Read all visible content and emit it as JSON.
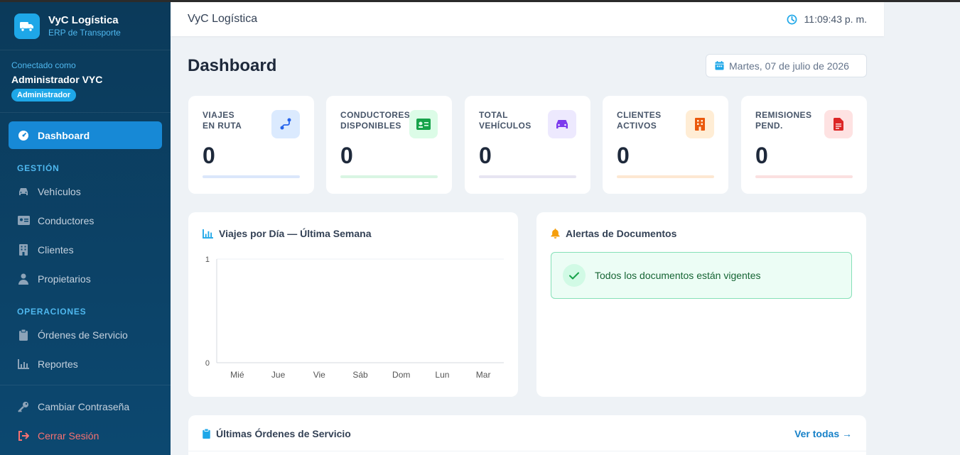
{
  "brand": {
    "name": "VyC Logística",
    "subtitle": "ERP de Transporte"
  },
  "user": {
    "connected_label": "Conectado como",
    "name": "Administrador VYC",
    "role": "Administrador"
  },
  "nav": {
    "dashboard": "Dashboard",
    "section_gestion": "GESTIÓN",
    "vehiculos": "Vehículos",
    "conductores": "Conductores",
    "clientes": "Clientes",
    "propietarios": "Propietarios",
    "section_operaciones": "OPERACIONES",
    "ordenes": "Órdenes de Servicio",
    "reportes": "Reportes",
    "cambiar_password": "Cambiar Contraseña",
    "cerrar_sesion": "Cerrar Sesión"
  },
  "header": {
    "title": "VyC Logística",
    "time": "11:09:43 p. m."
  },
  "page": {
    "title": "Dashboard",
    "date": "Martes, 07 de julio de 2026"
  },
  "stats": [
    {
      "label_line1": "VIAJES",
      "label_line2": "EN RUTA",
      "value": "0"
    },
    {
      "label_line1": "CONDUCTORES",
      "label_line2": "DISPONIBLES",
      "value": "0"
    },
    {
      "label_line1": "TOTAL",
      "label_line2": "VEHÍCULOS",
      "value": "0"
    },
    {
      "label_line1": "CLIENTES",
      "label_line2": "ACTIVOS",
      "value": "0"
    },
    {
      "label_line1": "REMISIONES",
      "label_line2": "PEND.",
      "value": "0"
    }
  ],
  "colors": {
    "accent": "#1789d6",
    "stat_blue": "#dbeafe",
    "stat_green": "#dcfce7",
    "stat_purple": "#ede9fe",
    "stat_orange": "#ffedd5",
    "stat_red": "#fee2e2"
  },
  "chart_card": {
    "title": "Viajes por Día — Última Semana"
  },
  "chart_data": {
    "type": "bar",
    "categories": [
      "Mié",
      "Jue",
      "Vie",
      "Sáb",
      "Dom",
      "Lun",
      "Mar"
    ],
    "values": [
      0,
      0,
      0,
      0,
      0,
      0,
      0
    ],
    "title": "Viajes por Día — Última Semana",
    "ylim": [
      0,
      1
    ],
    "yticks": [
      "0",
      "1"
    ]
  },
  "alerts_card": {
    "title": "Alertas de Documentos",
    "ok_message": "Todos los documentos están vigentes"
  },
  "orders_card": {
    "title": "Últimas Órdenes de Servicio",
    "see_all": "Ver todas →"
  }
}
